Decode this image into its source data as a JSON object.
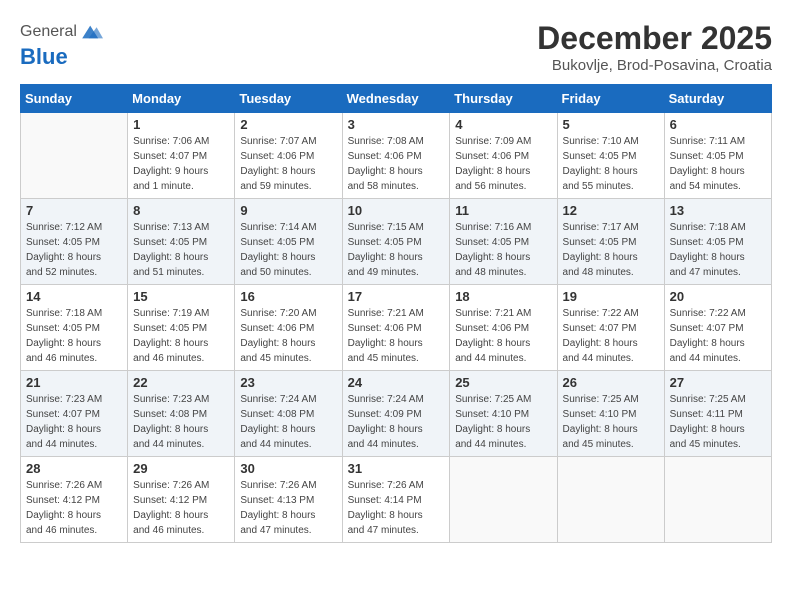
{
  "header": {
    "logo_line1": "General",
    "logo_line2": "Blue",
    "month": "December 2025",
    "location": "Bukovlje, Brod-Posavina, Croatia"
  },
  "weekdays": [
    "Sunday",
    "Monday",
    "Tuesday",
    "Wednesday",
    "Thursday",
    "Friday",
    "Saturday"
  ],
  "weeks": [
    [
      {
        "day": "",
        "info": ""
      },
      {
        "day": "1",
        "info": "Sunrise: 7:06 AM\nSunset: 4:07 PM\nDaylight: 9 hours\nand 1 minute."
      },
      {
        "day": "2",
        "info": "Sunrise: 7:07 AM\nSunset: 4:06 PM\nDaylight: 8 hours\nand 59 minutes."
      },
      {
        "day": "3",
        "info": "Sunrise: 7:08 AM\nSunset: 4:06 PM\nDaylight: 8 hours\nand 58 minutes."
      },
      {
        "day": "4",
        "info": "Sunrise: 7:09 AM\nSunset: 4:06 PM\nDaylight: 8 hours\nand 56 minutes."
      },
      {
        "day": "5",
        "info": "Sunrise: 7:10 AM\nSunset: 4:05 PM\nDaylight: 8 hours\nand 55 minutes."
      },
      {
        "day": "6",
        "info": "Sunrise: 7:11 AM\nSunset: 4:05 PM\nDaylight: 8 hours\nand 54 minutes."
      }
    ],
    [
      {
        "day": "7",
        "info": "Sunrise: 7:12 AM\nSunset: 4:05 PM\nDaylight: 8 hours\nand 52 minutes."
      },
      {
        "day": "8",
        "info": "Sunrise: 7:13 AM\nSunset: 4:05 PM\nDaylight: 8 hours\nand 51 minutes."
      },
      {
        "day": "9",
        "info": "Sunrise: 7:14 AM\nSunset: 4:05 PM\nDaylight: 8 hours\nand 50 minutes."
      },
      {
        "day": "10",
        "info": "Sunrise: 7:15 AM\nSunset: 4:05 PM\nDaylight: 8 hours\nand 49 minutes."
      },
      {
        "day": "11",
        "info": "Sunrise: 7:16 AM\nSunset: 4:05 PM\nDaylight: 8 hours\nand 48 minutes."
      },
      {
        "day": "12",
        "info": "Sunrise: 7:17 AM\nSunset: 4:05 PM\nDaylight: 8 hours\nand 48 minutes."
      },
      {
        "day": "13",
        "info": "Sunrise: 7:18 AM\nSunset: 4:05 PM\nDaylight: 8 hours\nand 47 minutes."
      }
    ],
    [
      {
        "day": "14",
        "info": "Sunrise: 7:18 AM\nSunset: 4:05 PM\nDaylight: 8 hours\nand 46 minutes."
      },
      {
        "day": "15",
        "info": "Sunrise: 7:19 AM\nSunset: 4:05 PM\nDaylight: 8 hours\nand 46 minutes."
      },
      {
        "day": "16",
        "info": "Sunrise: 7:20 AM\nSunset: 4:06 PM\nDaylight: 8 hours\nand 45 minutes."
      },
      {
        "day": "17",
        "info": "Sunrise: 7:21 AM\nSunset: 4:06 PM\nDaylight: 8 hours\nand 45 minutes."
      },
      {
        "day": "18",
        "info": "Sunrise: 7:21 AM\nSunset: 4:06 PM\nDaylight: 8 hours\nand 44 minutes."
      },
      {
        "day": "19",
        "info": "Sunrise: 7:22 AM\nSunset: 4:07 PM\nDaylight: 8 hours\nand 44 minutes."
      },
      {
        "day": "20",
        "info": "Sunrise: 7:22 AM\nSunset: 4:07 PM\nDaylight: 8 hours\nand 44 minutes."
      }
    ],
    [
      {
        "day": "21",
        "info": "Sunrise: 7:23 AM\nSunset: 4:07 PM\nDaylight: 8 hours\nand 44 minutes."
      },
      {
        "day": "22",
        "info": "Sunrise: 7:23 AM\nSunset: 4:08 PM\nDaylight: 8 hours\nand 44 minutes."
      },
      {
        "day": "23",
        "info": "Sunrise: 7:24 AM\nSunset: 4:08 PM\nDaylight: 8 hours\nand 44 minutes."
      },
      {
        "day": "24",
        "info": "Sunrise: 7:24 AM\nSunset: 4:09 PM\nDaylight: 8 hours\nand 44 minutes."
      },
      {
        "day": "25",
        "info": "Sunrise: 7:25 AM\nSunset: 4:10 PM\nDaylight: 8 hours\nand 44 minutes."
      },
      {
        "day": "26",
        "info": "Sunrise: 7:25 AM\nSunset: 4:10 PM\nDaylight: 8 hours\nand 45 minutes."
      },
      {
        "day": "27",
        "info": "Sunrise: 7:25 AM\nSunset: 4:11 PM\nDaylight: 8 hours\nand 45 minutes."
      }
    ],
    [
      {
        "day": "28",
        "info": "Sunrise: 7:26 AM\nSunset: 4:12 PM\nDaylight: 8 hours\nand 46 minutes."
      },
      {
        "day": "29",
        "info": "Sunrise: 7:26 AM\nSunset: 4:12 PM\nDaylight: 8 hours\nand 46 minutes."
      },
      {
        "day": "30",
        "info": "Sunrise: 7:26 AM\nSunset: 4:13 PM\nDaylight: 8 hours\nand 47 minutes."
      },
      {
        "day": "31",
        "info": "Sunrise: 7:26 AM\nSunset: 4:14 PM\nDaylight: 8 hours\nand 47 minutes."
      },
      {
        "day": "",
        "info": ""
      },
      {
        "day": "",
        "info": ""
      },
      {
        "day": "",
        "info": ""
      }
    ]
  ]
}
